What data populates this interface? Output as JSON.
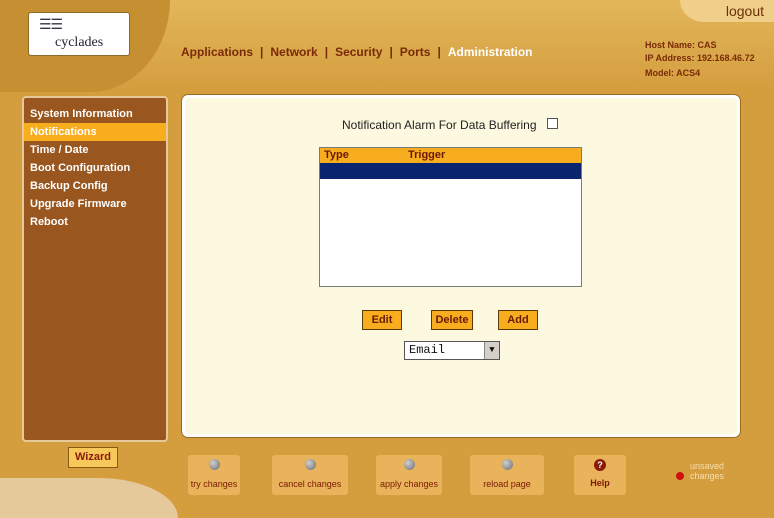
{
  "header": {
    "logo_text": "cyclades",
    "nav": [
      "Applications",
      "Network",
      "Security",
      "Ports",
      "Administration"
    ],
    "active_nav": "Administration",
    "logout": "logout",
    "host_name": "Host Name: CAS",
    "ip_address": "IP Address: 192.168.46.72",
    "model": "Model: ACS4"
  },
  "sidebar": {
    "items": [
      {
        "label": "System Information"
      },
      {
        "label": "Notifications"
      },
      {
        "label": "Time / Date"
      },
      {
        "label": "Boot Configuration"
      },
      {
        "label": "Backup Config"
      },
      {
        "label": "Upgrade Firmware"
      },
      {
        "label": "Reboot"
      }
    ],
    "active": "Notifications",
    "wizard": "Wizard"
  },
  "main": {
    "alarm_label": "Notification Alarm For Data Buffering",
    "alarm_checked": false,
    "table": {
      "columns": [
        "Type",
        "Trigger"
      ],
      "rows": [
        {
          "type": "",
          "trigger": ""
        }
      ]
    },
    "buttons": {
      "edit": "Edit",
      "delete": "Delete",
      "add": "Add"
    },
    "select_value": "Email"
  },
  "toolbar": {
    "try": "try changes",
    "cancel": "cancel changes",
    "apply": "apply changes",
    "reload": "reload page",
    "help": "Help",
    "unsaved": "unsaved changes"
  },
  "colors": {
    "header": "#d49d3e",
    "sidebar": "#99561e",
    "accent": "#f7ad1e",
    "selection": "#0a2470",
    "panel": "#fdf8e0"
  },
  "icons": {
    "logo": "cyclades-logo-icon",
    "help": "question-mark-icon",
    "tools": "gray-dot-icon",
    "unsaved": "red-dot-icon"
  }
}
